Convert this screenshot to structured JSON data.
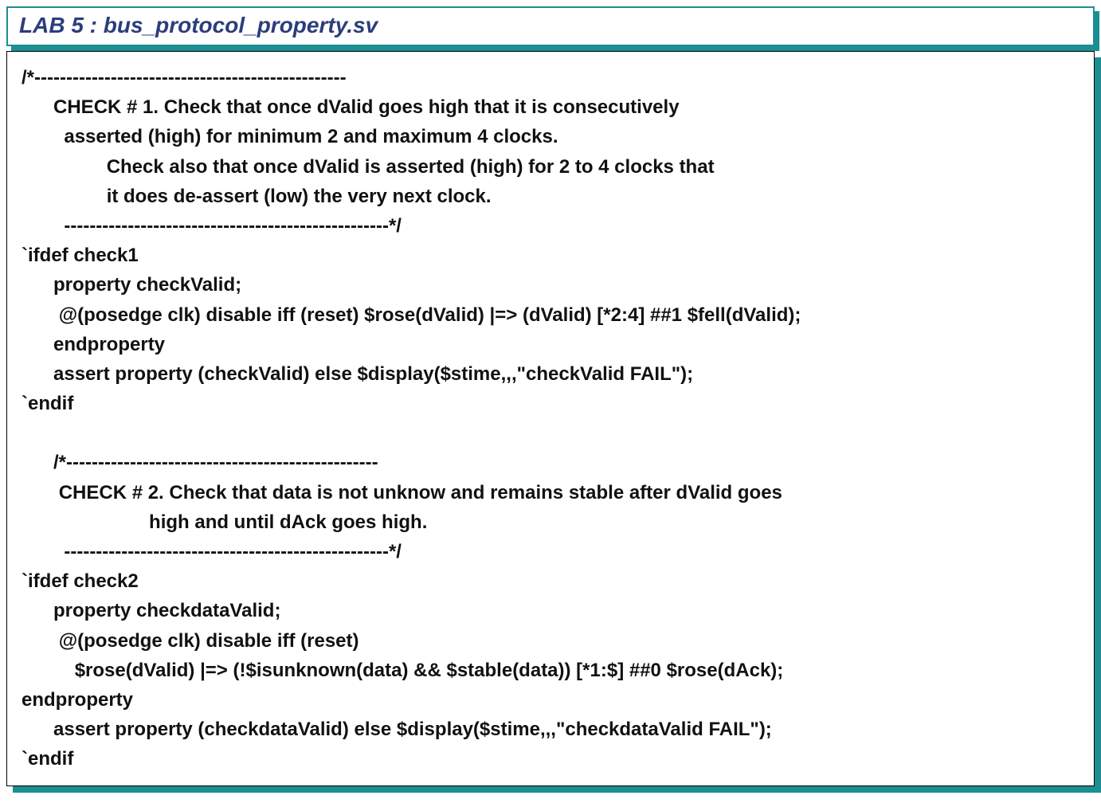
{
  "title": "LAB 5 : bus_protocol_property.sv",
  "code": {
    "l01": "/*-------------------------------------------------",
    "l02": "      CHECK # 1. Check that once dValid goes high that it is consecutively",
    "l03": "        asserted (high) for minimum 2 and maximum 4 clocks.",
    "l04": "                Check also that once dValid is asserted (high) for 2 to 4 clocks that",
    "l05": "                it does de-assert (low) the very next clock.",
    "l06": "        ---------------------------------------------------*/",
    "l07": "`ifdef check1",
    "l08": "      property checkValid;",
    "l09": "       @(posedge clk) disable iff (reset) $rose(dValid) |=> (dValid) [*2:4] ##1 $fell(dValid);",
    "l10": "      endproperty",
    "l11": "      assert property (checkValid) else $display($stime,,,\"checkValid FAIL\");",
    "l12": "`endif",
    "l13": "",
    "l14": "      /*-------------------------------------------------",
    "l15": "       CHECK # 2. Check that data is not unknow and remains stable after dValid goes",
    "l16": "                        high and until dAck goes high.",
    "l17": "        ---------------------------------------------------*/",
    "l18": "`ifdef check2",
    "l19": "      property checkdataValid;",
    "l20": "       @(posedge clk) disable iff (reset)",
    "l21": "          $rose(dValid) |=> (!$isunknown(data) && $stable(data)) [*1:$] ##0 $rose(dAck);",
    "l22": "endproperty",
    "l23": "      assert property (checkdataValid) else $display($stime,,,\"checkdataValid FAIL\");",
    "l24": "`endif"
  }
}
